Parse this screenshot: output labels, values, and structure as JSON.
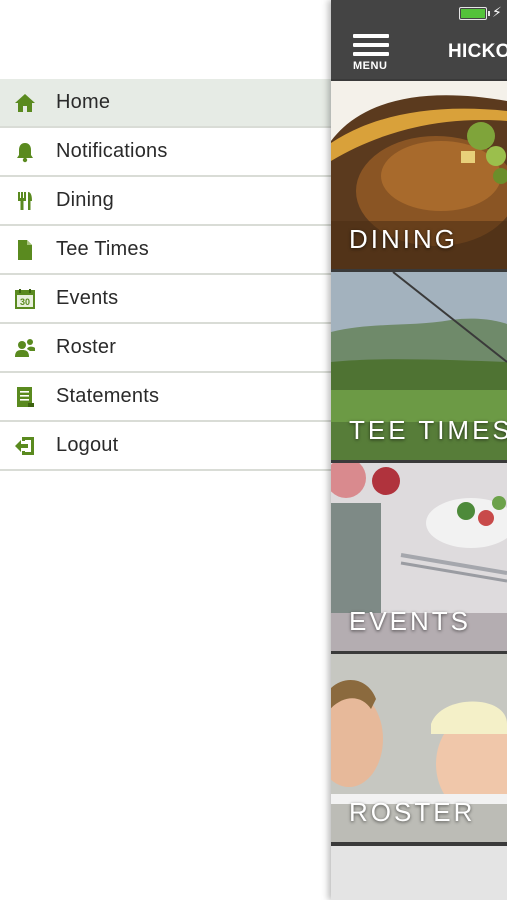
{
  "drawer": {
    "items": [
      {
        "label": "Home",
        "icon": "home-icon",
        "active": true
      },
      {
        "label": "Notifications",
        "icon": "bell-icon",
        "active": false
      },
      {
        "label": "Dining",
        "icon": "fork-knife-icon",
        "active": false
      },
      {
        "label": "Tee Times",
        "icon": "document-icon",
        "active": false
      },
      {
        "label": "Events",
        "icon": "calendar-icon",
        "active": false
      },
      {
        "label": "Roster",
        "icon": "people-icon",
        "active": false
      },
      {
        "label": "Statements",
        "icon": "statement-icon",
        "active": false
      },
      {
        "label": "Logout",
        "icon": "logout-icon",
        "active": false
      }
    ],
    "calendar_day": "30"
  },
  "topbar": {
    "menu_label": "MENU",
    "club_name": "HICKORY"
  },
  "tiles": [
    {
      "label": "DINING"
    },
    {
      "label": "TEE TIMES"
    },
    {
      "label": "EVENTS"
    },
    {
      "label": "ROSTER"
    }
  ],
  "colors": {
    "accent_green": "#5a8a1f",
    "active_row_bg": "#e6ebe5",
    "topbar_bg": "#444444",
    "battery_green": "#54c23a"
  }
}
